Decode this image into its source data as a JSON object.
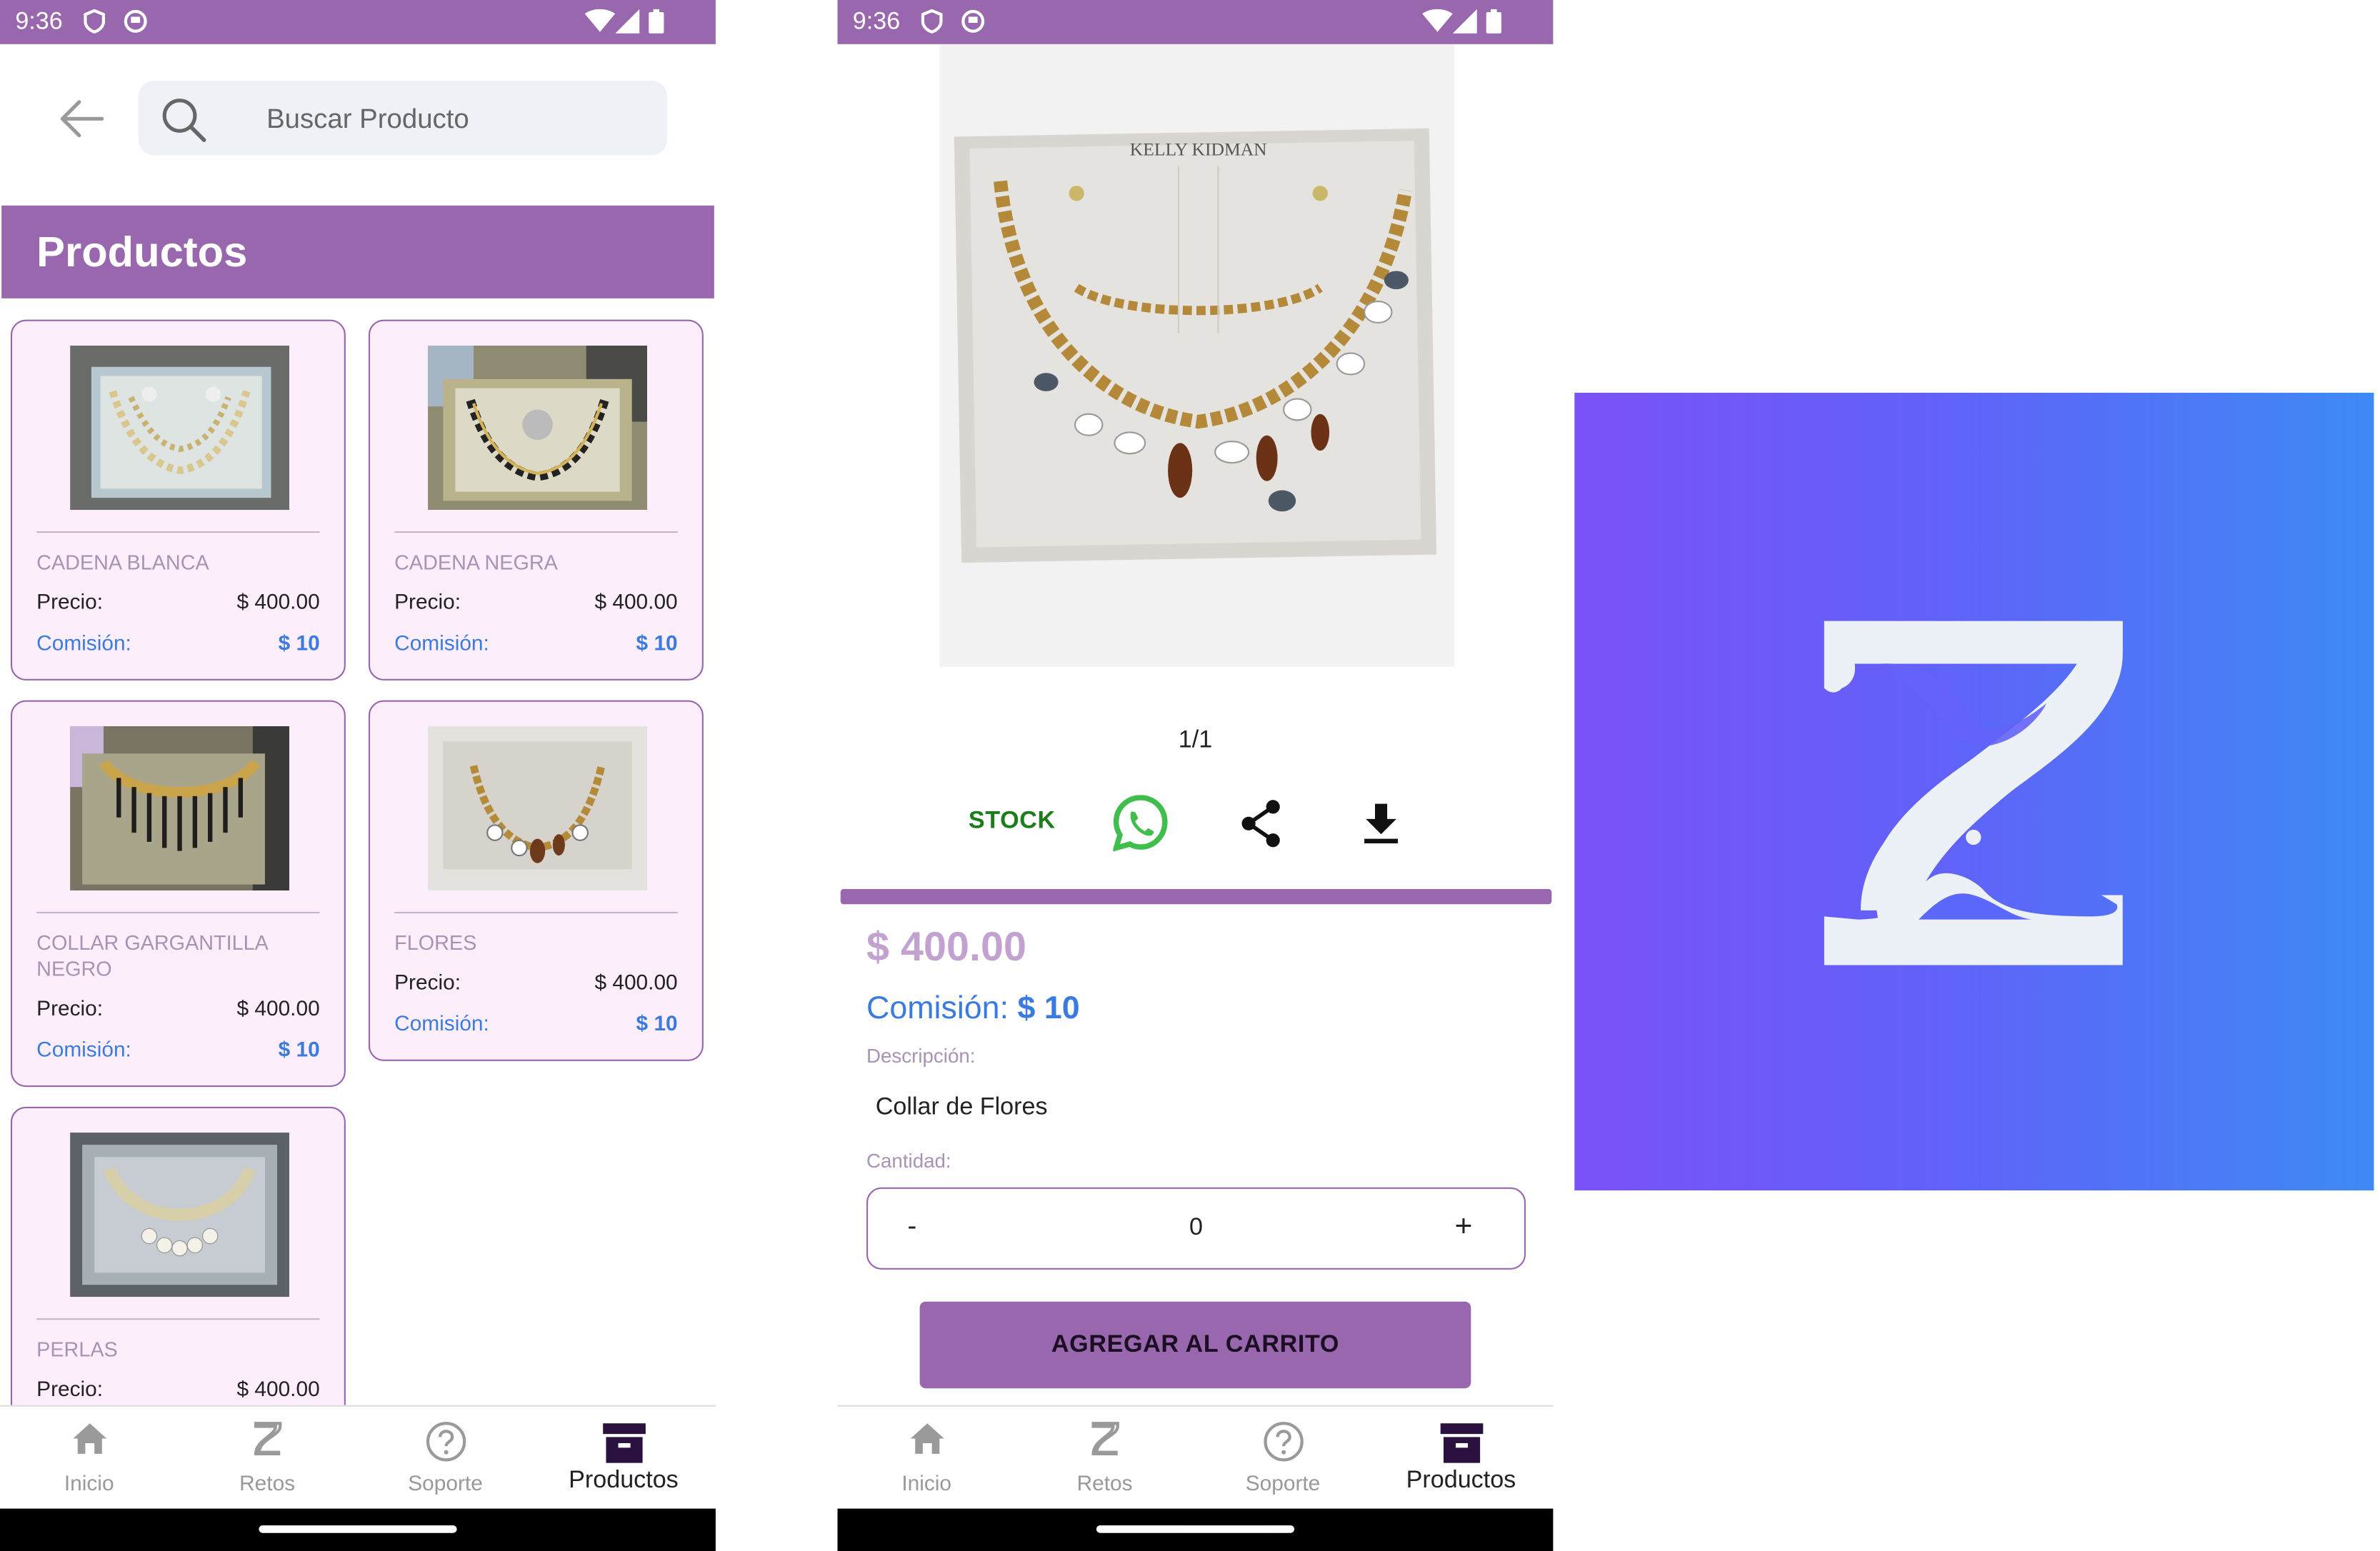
{
  "status_bar": {
    "time": "9:36"
  },
  "search": {
    "placeholder": "Buscar Producto"
  },
  "products_header": "Productos",
  "products": [
    {
      "name": "CADENA BLANCA",
      "price_label": "Precio:",
      "price": "$ 400.00",
      "commission_label": "Comisión:",
      "commission": "$ 10"
    },
    {
      "name": "CADENA NEGRA",
      "price_label": "Precio:",
      "price": "$ 400.00",
      "commission_label": "Comisión:",
      "commission": "$ 10"
    },
    {
      "name": "COLLAR GARGANTILLA NEGRO",
      "price_label": "Precio:",
      "price": "$ 400.00",
      "commission_label": "Comisión:",
      "commission": "$ 10"
    },
    {
      "name": "FLORES",
      "price_label": "Precio:",
      "price": "$ 400.00",
      "commission_label": "Comisión:",
      "commission": "$ 10"
    },
    {
      "name": "PERLAS",
      "price_label": "Precio:",
      "price": "$ 400.00"
    }
  ],
  "detail": {
    "image_brand_text": "KELLY KIDMAN",
    "pager": "1/1",
    "stock_label": "STOCK",
    "price": "$ 400.00",
    "commission_label": "Comisión:",
    "commission_value": "$ 10",
    "description_label": "Descripción:",
    "description": "Collar de Flores",
    "quantity_label": "Cantidad:",
    "quantity_minus": "-",
    "quantity_value": "0",
    "quantity_plus": "+",
    "add_to_cart": "AGREGAR AL CARRITO"
  },
  "bottom_nav": [
    {
      "label": "Inicio",
      "icon": "home-icon"
    },
    {
      "label": "Retos",
      "icon": "hourglass-icon"
    },
    {
      "label": "Soporte",
      "icon": "help-circle-icon"
    },
    {
      "label": "Productos",
      "icon": "archive-box-icon",
      "active": true
    }
  ],
  "colors": {
    "primary": "#9867ad",
    "card_bg": "#fdeefb",
    "commission_blue": "#3b7be0",
    "stock_green": "#1b7d1b",
    "logo_gradient_start": "#7b52f7",
    "logo_gradient_end": "#3d8af5"
  }
}
